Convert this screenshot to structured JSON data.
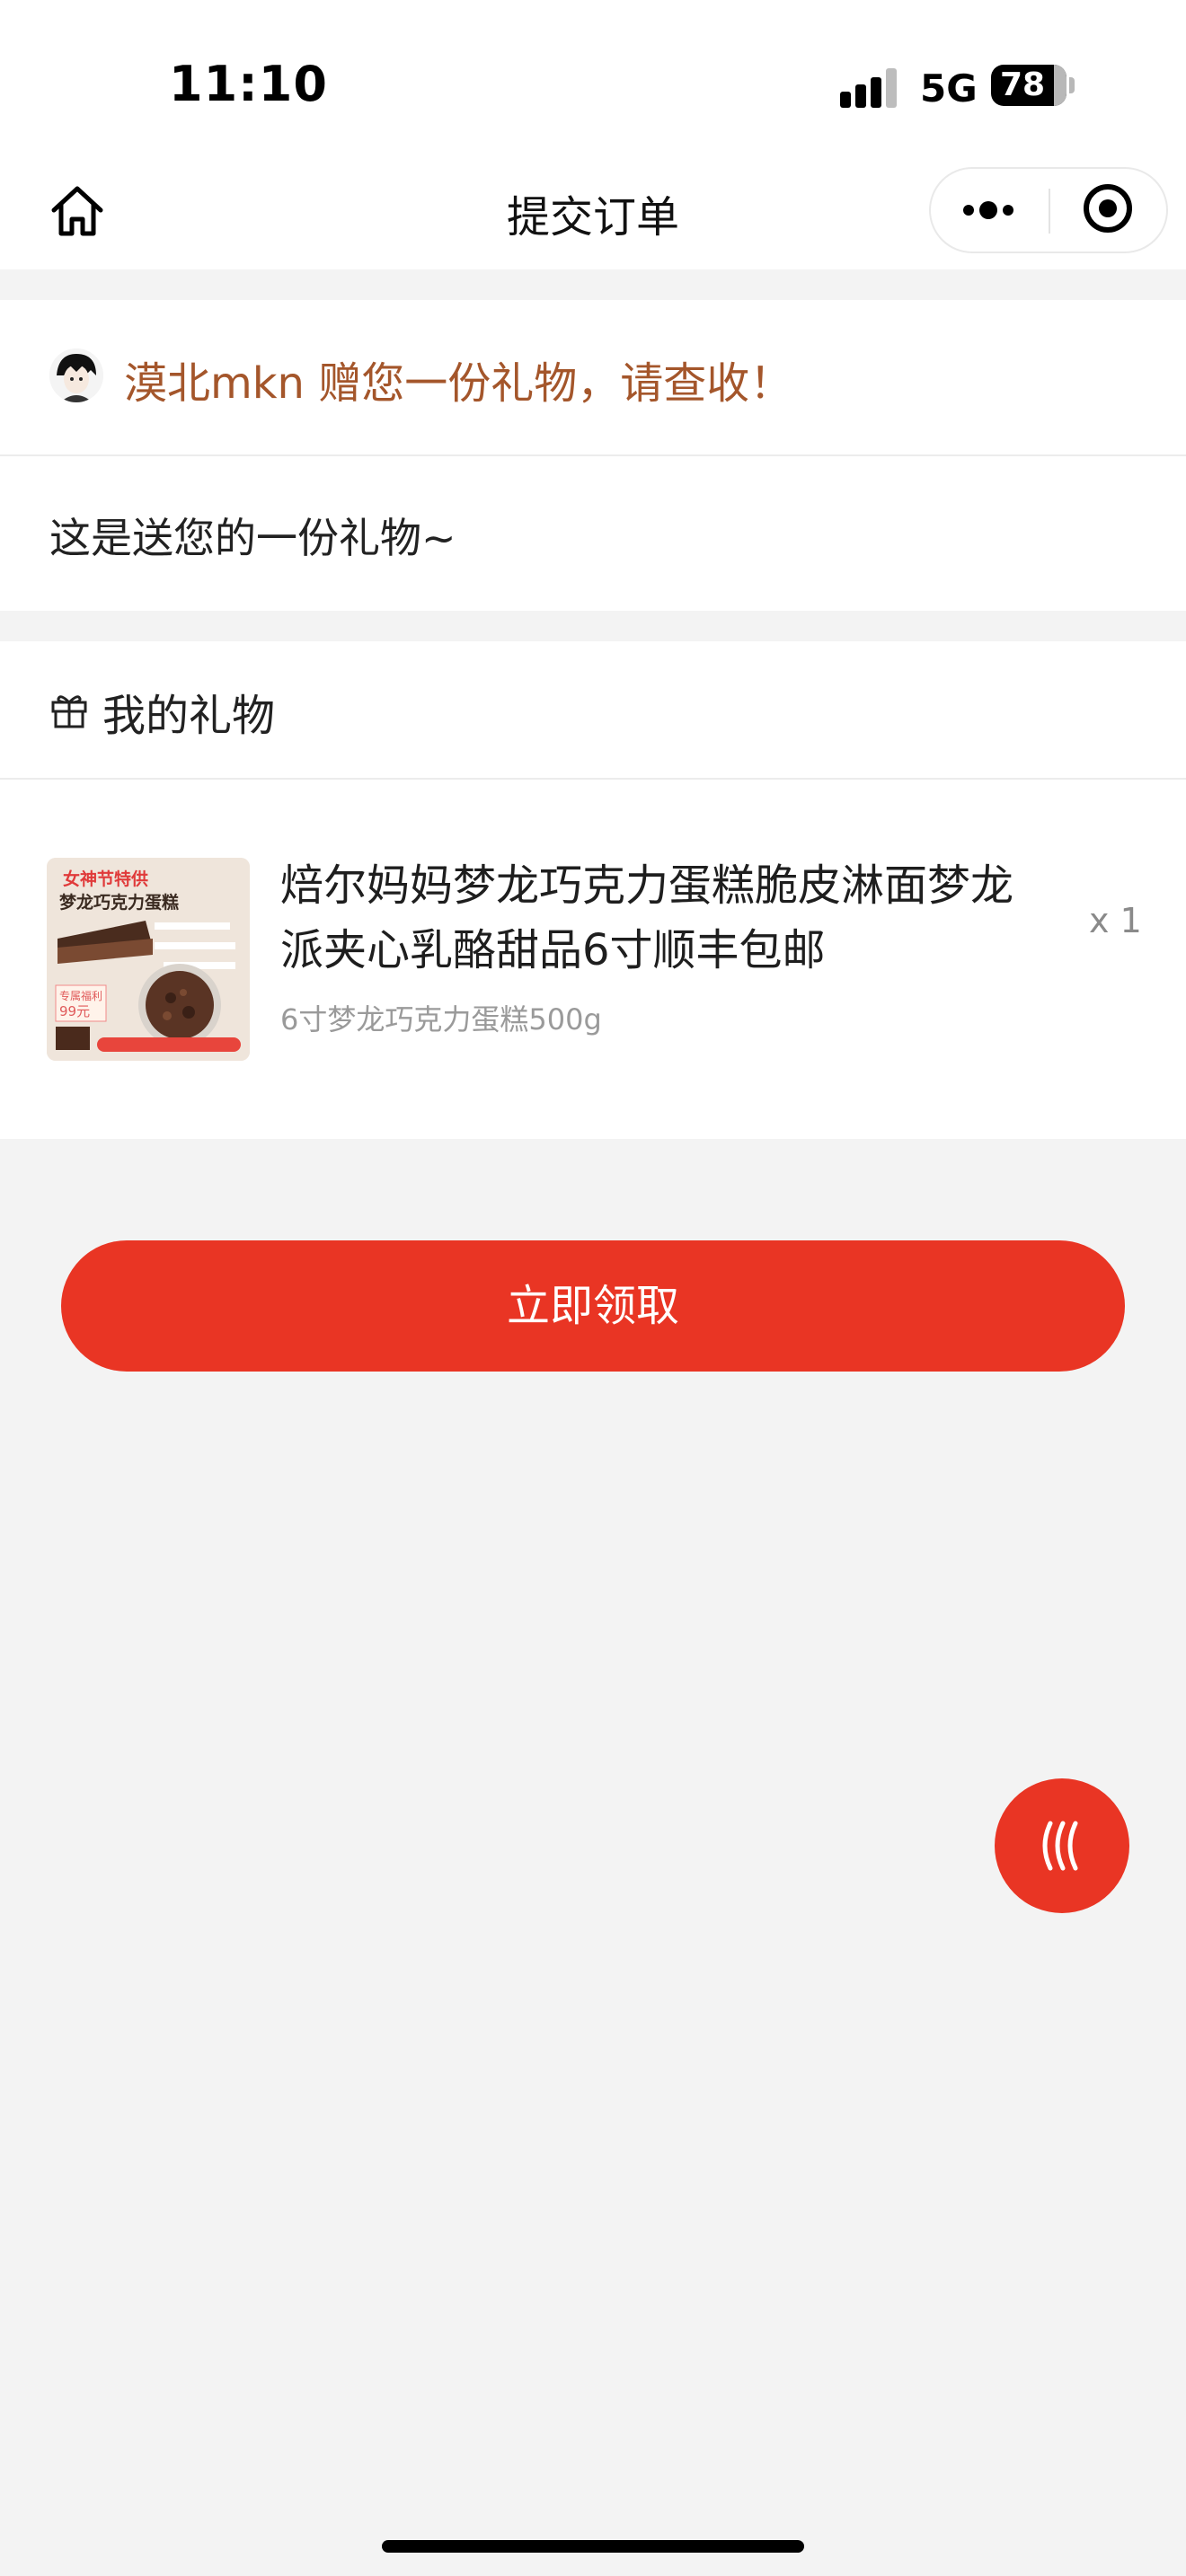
{
  "status_bar": {
    "time": "11:10",
    "network": "5G",
    "battery": "78"
  },
  "nav": {
    "title": "提交订单",
    "icons": [
      "home-icon",
      "more-icon",
      "target-icon"
    ]
  },
  "gift_header": {
    "text": "漠北mkn 赠您一份礼物，请查收！",
    "color": "#a4562b"
  },
  "message": "这是送您的一份礼物~",
  "gifts_section": {
    "label": "我的礼物"
  },
  "product": {
    "title": "焙尔妈妈梦龙巧克力蛋糕脆皮淋面梦龙派夹心乳酪甜品6寸顺丰包邮",
    "spec": "6寸梦龙巧克力蛋糕500g",
    "quantity": "x 1",
    "image_texts": {
      "headline": "女神节特供",
      "subhead": "梦龙巧克力蛋糕",
      "price_tag": "专属福利",
      "price": "99元"
    }
  },
  "cta": {
    "label": "立即领取",
    "color": "#e93524"
  },
  "floating_button": {
    "icon": "wave-icon"
  }
}
